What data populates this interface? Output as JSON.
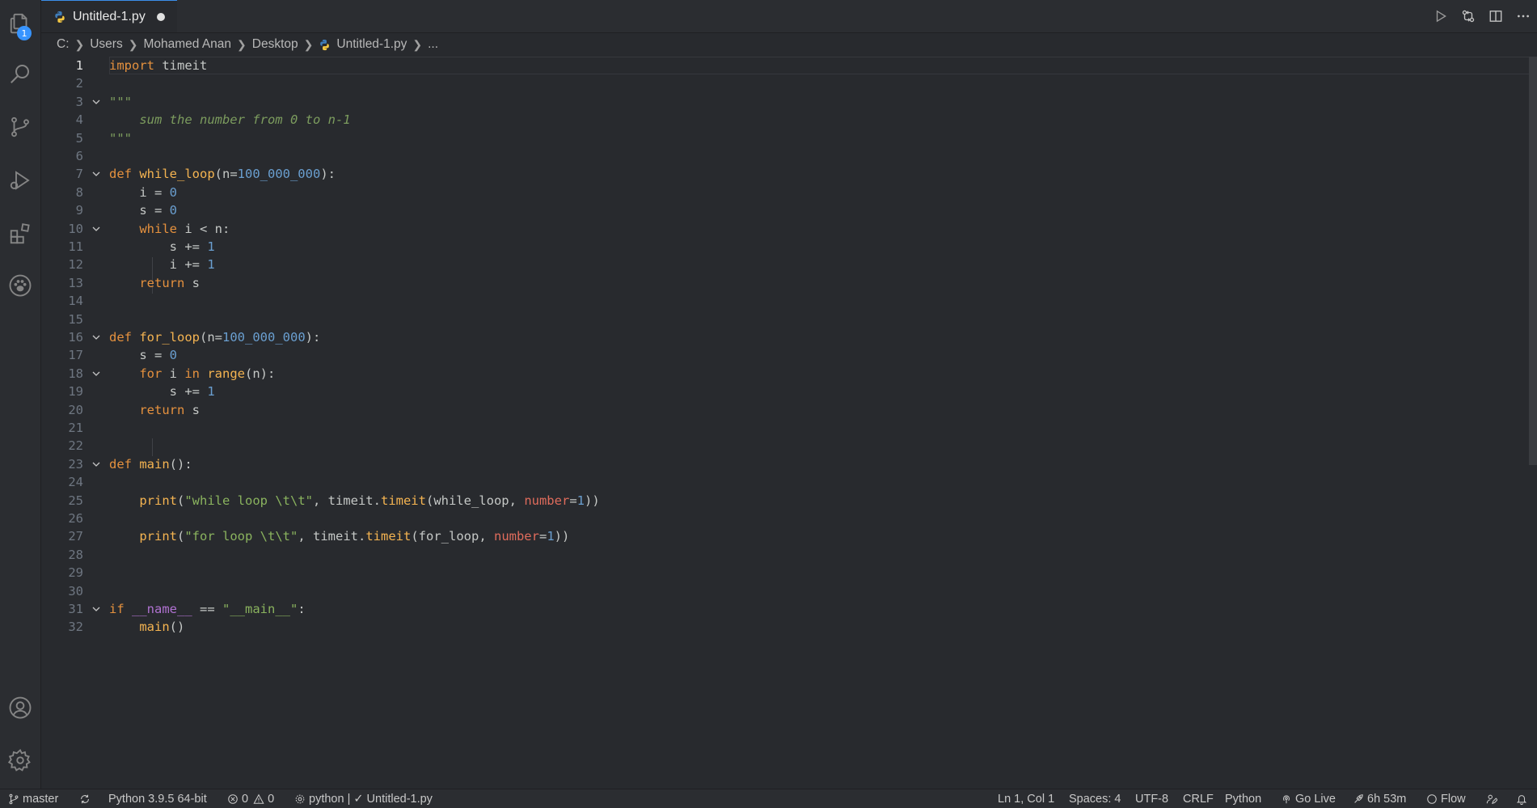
{
  "activity": {
    "explorer_badge": "1"
  },
  "tab": {
    "title": "Untitled-1.py"
  },
  "breadcrumb": {
    "items": [
      "C:",
      "Users",
      "Mohamed Anan",
      "Desktop",
      "Untitled-1.py",
      "..."
    ]
  },
  "editor": {
    "lines": [
      {
        "n": "1"
      },
      {
        "n": "2"
      },
      {
        "n": "3"
      },
      {
        "n": "4"
      },
      {
        "n": "5"
      },
      {
        "n": "6"
      },
      {
        "n": "7"
      },
      {
        "n": "8"
      },
      {
        "n": "9"
      },
      {
        "n": "10"
      },
      {
        "n": "11"
      },
      {
        "n": "12"
      },
      {
        "n": "13"
      },
      {
        "n": "14"
      },
      {
        "n": "15"
      },
      {
        "n": "16"
      },
      {
        "n": "17"
      },
      {
        "n": "18"
      },
      {
        "n": "19"
      },
      {
        "n": "20"
      },
      {
        "n": "21"
      },
      {
        "n": "22"
      },
      {
        "n": "23"
      },
      {
        "n": "24"
      },
      {
        "n": "25"
      },
      {
        "n": "26"
      },
      {
        "n": "27"
      },
      {
        "n": "28"
      },
      {
        "n": "29"
      },
      {
        "n": "30"
      },
      {
        "n": "31"
      },
      {
        "n": "32"
      }
    ],
    "code": {
      "l1_kw": "import",
      "l1_mod": " timeit",
      "l3": "\"\"\"",
      "l4": "    sum the number from 0 to n-1",
      "l5": "\"\"\"",
      "l7_kw": "def",
      "l7_fn": " while_loop",
      "l7_a": "(n=",
      "l7_num": "100_000_000",
      "l7_b": "):",
      "l8_a": "    i = ",
      "l8_num": "0",
      "l9_a": "    s = ",
      "l9_num": "0",
      "l10_kw": "    while",
      "l10_a": " i < n:",
      "l11_a": "        s += ",
      "l11_num": "1",
      "l12_a": "        i += ",
      "l12_num": "1",
      "l13_kw": "    return",
      "l13_a": " s",
      "l16_kw": "def",
      "l16_fn": " for_loop",
      "l16_a": "(n=",
      "l16_num": "100_000_000",
      "l16_b": "):",
      "l17_a": "    s = ",
      "l17_num": "0",
      "l18_kw": "    for",
      "l18_a": " i ",
      "l18_kw2": "in",
      "l18_fn": " range",
      "l18_b": "(n):",
      "l19_a": "        s += ",
      "l19_num": "1",
      "l20_kw": "    return",
      "l20_a": " s",
      "l23_kw": "def",
      "l23_fn": " main",
      "l23_a": "():",
      "l25_fn": "    print",
      "l25_a": "(",
      "l25_str": "\"while loop \\t\\t\"",
      "l25_b": ", timeit.",
      "l25_fn2": "timeit",
      "l25_c": "(while_loop, ",
      "l25_param": "number",
      "l25_d": "=",
      "l25_num": "1",
      "l25_e": "))",
      "l27_fn": "    print",
      "l27_a": "(",
      "l27_str": "\"for loop \\t\\t\"",
      "l27_b": ", timeit.",
      "l27_fn2": "timeit",
      "l27_c": "(for_loop, ",
      "l27_param": "number",
      "l27_d": "=",
      "l27_num": "1",
      "l27_e": "))",
      "l31_kw": "if",
      "l31_a": " ",
      "l31_dunder": "__name__",
      "l31_b": " == ",
      "l31_str": "\"__main__\"",
      "l31_c": ":",
      "l32_fn": "    main",
      "l32_a": "()"
    }
  },
  "statusbar": {
    "branch": "master",
    "interpreter": "Python 3.9.5 64-bit",
    "errors": "0",
    "warnings": "0",
    "lint": "python | ✓ Untitled-1.py",
    "position": "Ln 1, Col 1",
    "spaces": "Spaces: 4",
    "encoding": "UTF-8",
    "eol": "CRLF",
    "language": "Python",
    "golive": "Go Live",
    "time": "6h 53m",
    "flow": "Flow"
  }
}
